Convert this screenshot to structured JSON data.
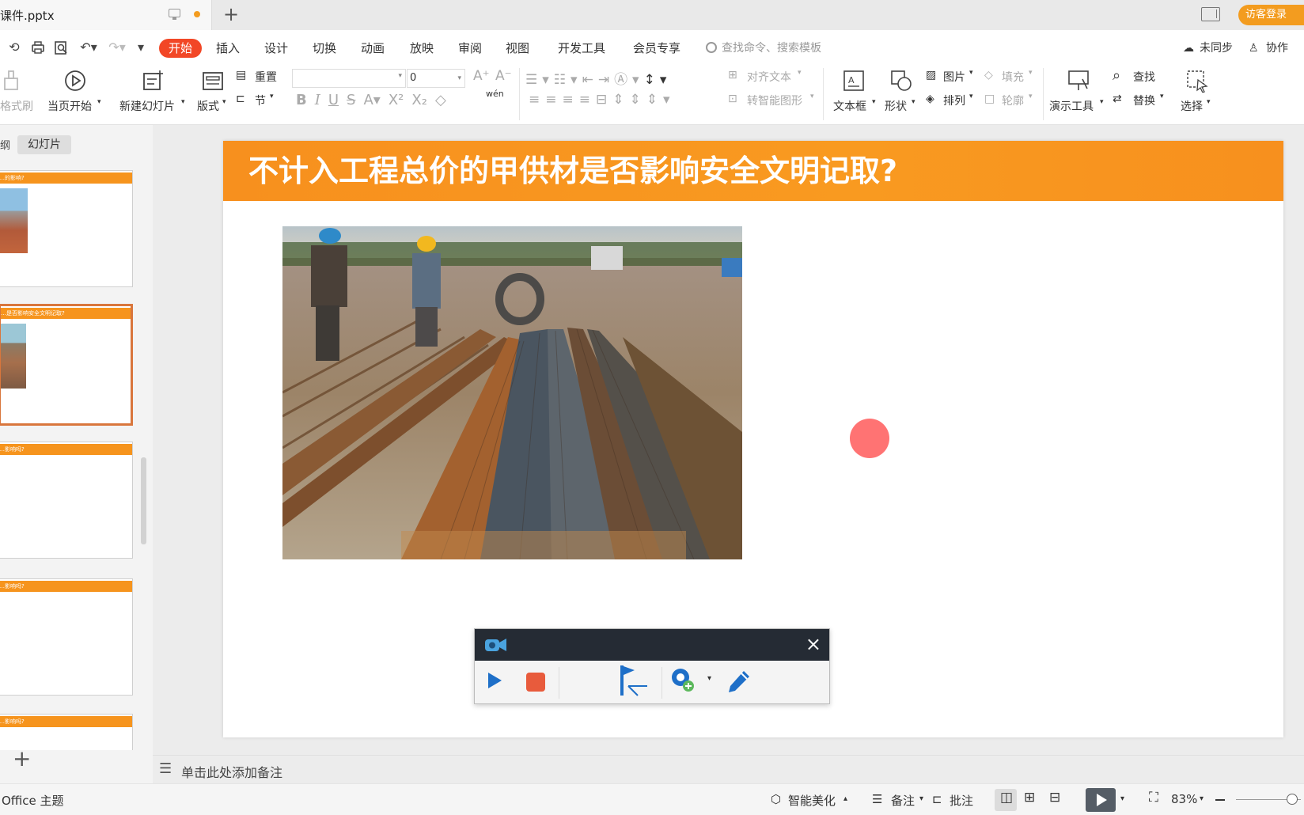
{
  "titlebar": {
    "doc_name": "课件.pptx",
    "new_tab": "+",
    "guest_login": "访客登录"
  },
  "menu": {
    "tabs": [
      "开始",
      "插入",
      "设计",
      "切换",
      "动画",
      "放映",
      "审阅",
      "视图",
      "开发工具",
      "会员专享"
    ],
    "active_tab": "开始",
    "search_placeholder": "查找命令、搜索模板",
    "sync": "未同步",
    "collab": "协作"
  },
  "ribbon": {
    "format_painter": "格式刷",
    "from_current": "当页开始",
    "new_slide": "新建幻灯片",
    "layout": "版式",
    "reset": "重置",
    "section": "节",
    "font_size": "0",
    "align_text": "对齐文本",
    "smart_shape": "转智能图形",
    "textbox": "文本框",
    "shapes": "形状",
    "picture": "图片",
    "arrange": "排列",
    "fill": "填充",
    "outline": "轮廓",
    "present_tools": "演示工具",
    "find": "查找",
    "replace": "替换",
    "select": "选择",
    "wen_label": "wén"
  },
  "left_pane": {
    "tab_outline": "纲",
    "tab_slides": "幻灯片",
    "thumbnails": [
      {
        "title": "…的影响?"
      },
      {
        "title": "…是否影响安全文明记取?"
      },
      {
        "title": "…影响吗?"
      },
      {
        "title": "…影响吗?"
      },
      {
        "title": "…影响吗?"
      }
    ],
    "add_slide": "+"
  },
  "slide": {
    "title": "不计入工程总价的甲供材是否影响安全文明记取?"
  },
  "recorder": {
    "close": "×"
  },
  "notes": {
    "placeholder": "单击此处添加备注"
  },
  "status": {
    "theme": "Office 主题",
    "beautify": "智能美化",
    "notes": "备注",
    "comments": "批注",
    "zoom": "83%"
  },
  "colors": {
    "accent_orange": "#f6941d",
    "active_tab_red": "#f24726",
    "recorder_dark": "#252b34",
    "pointer_red": "#ff7373"
  }
}
